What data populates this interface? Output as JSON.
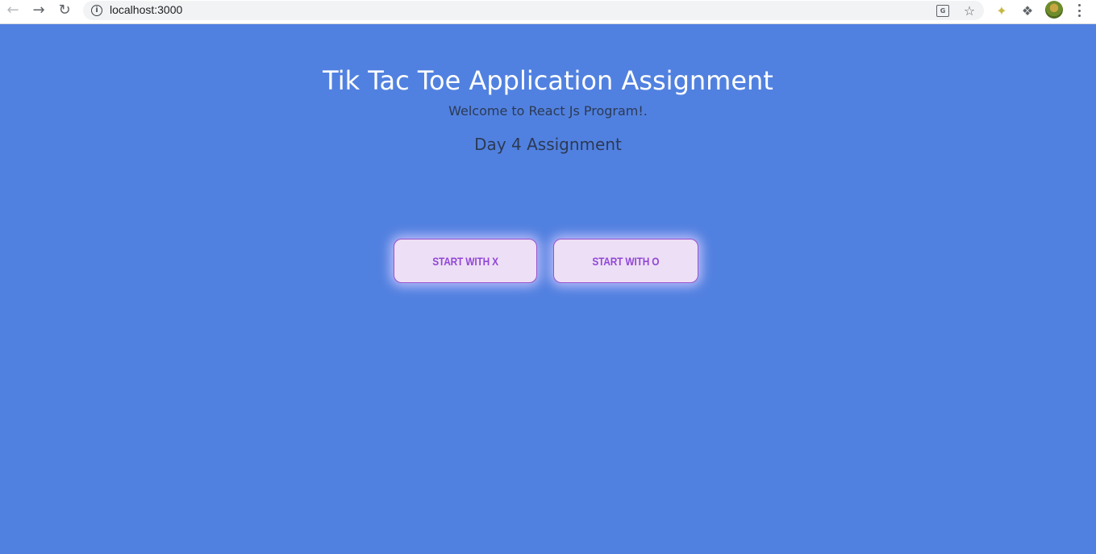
{
  "browser": {
    "url": "localhost:3000",
    "icons": {
      "back": "arrow-left-icon",
      "forward": "arrow-right-icon",
      "reload": "reload-icon",
      "site_info": "info-icon",
      "translate": "translate-icon",
      "bookmark": "star-icon",
      "extension_1": "extension-icon",
      "extensions": "puzzle-icon",
      "profile": "avatar",
      "menu": "kebab-menu-icon"
    }
  },
  "page": {
    "background_color": "#5181e0",
    "title": "Tik Tac Toe Application Assignment",
    "subtitle": "Welcome to React Js Program!.",
    "day_label": "Day 4 Assignment",
    "buttons": {
      "start_x": "START WITH X",
      "start_o": "START WITH O"
    },
    "button_colors": {
      "background": "#eddff5",
      "border": "#9a53cc",
      "text": "#9147d8"
    }
  }
}
